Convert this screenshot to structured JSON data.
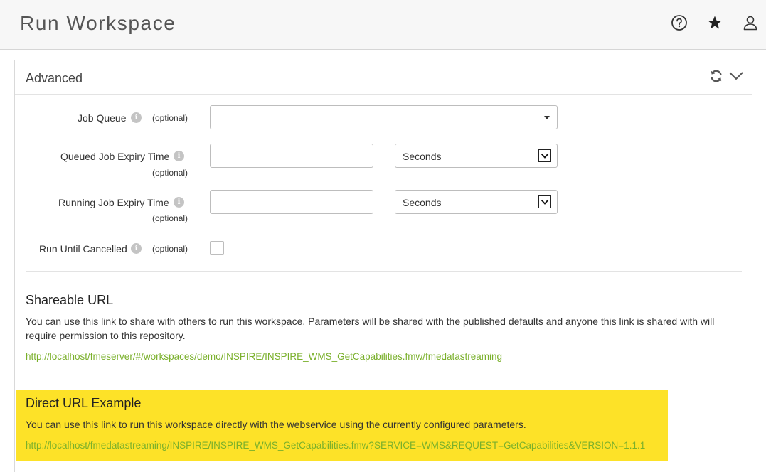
{
  "header": {
    "title": "Run Workspace",
    "icons": [
      "help-icon",
      "star-icon",
      "user-icon"
    ]
  },
  "panel": {
    "title": "Advanced"
  },
  "form": {
    "job_queue": {
      "label": "Job Queue",
      "optional": "(optional)",
      "value": ""
    },
    "queued_expiry": {
      "label": "Queued Job Expiry Time",
      "optional": "(optional)",
      "value": "",
      "unit": "Seconds"
    },
    "running_expiry": {
      "label": "Running Job Expiry Time",
      "optional": "(optional)",
      "value": "",
      "unit": "Seconds"
    },
    "run_until_cancelled": {
      "label": "Run Until Cancelled",
      "optional": "(optional)",
      "checked": false
    }
  },
  "shareable": {
    "title": "Shareable URL",
    "description": "You can use this link to share with others to run this workspace. Parameters will be shared with the published defaults and anyone this link is shared with will require permission to this repository.",
    "url": "http://localhost/fmeserver/#/workspaces/demo/INSPIRE/INSPIRE_WMS_GetCapabilities.fmw/fmedatastreaming"
  },
  "direct": {
    "title": "Direct URL Example",
    "description": "You can use this link to run this workspace directly with the webservice using the currently configured parameters.",
    "url": "http://localhost/fmedatastreaming/INSPIRE/INSPIRE_WMS_GetCapabilities.fmw?SERVICE=WMS&REQUEST=GetCapabilities&VERSION=1.1.1"
  },
  "colors": {
    "highlight": "#fde228",
    "link": "#7ab02b"
  }
}
